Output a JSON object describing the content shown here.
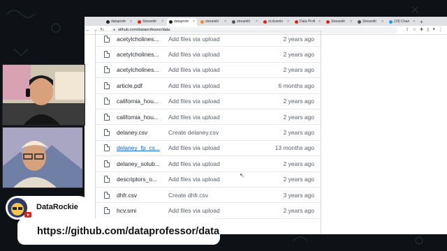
{
  "browser": {
    "tabs": [
      {
        "label": "dataprofe",
        "fav": "#222",
        "active": false
      },
      {
        "label": "Streamlit",
        "fav": "#e0241b",
        "active": false
      },
      {
        "label": "dataprofe",
        "fav": "#222",
        "active": true
      },
      {
        "label": "streamlit",
        "fav": "#f28b24",
        "active": false
      },
      {
        "label": "streamlit",
        "fav": "#555",
        "active": false
      },
      {
        "label": "st.downlo",
        "fav": "#e0241b",
        "active": false
      },
      {
        "label": "Data Profi",
        "fav": "#e0241b",
        "active": false
      },
      {
        "label": "Streamlit",
        "fav": "#e0241b",
        "active": false
      },
      {
        "label": "Streamlit",
        "fav": "#555",
        "active": false
      },
      {
        "label": "(19) Chan",
        "fav": "#1d9bf0",
        "active": false
      }
    ],
    "address": "github.com/dataprofessor/data"
  },
  "files": [
    {
      "name": "acetylcholines...",
      "message": "Add files via upload",
      "age": "2 years ago",
      "link": false
    },
    {
      "name": "acetylcholines...",
      "message": "Add files via upload",
      "age": "2 years ago",
      "link": false
    },
    {
      "name": "acetylcholines...",
      "message": "Add files via upload",
      "age": "2 years ago",
      "link": false
    },
    {
      "name": "article.pdf",
      "message": "Add files via upload",
      "age": "6 months ago",
      "link": false
    },
    {
      "name": "california_hou...",
      "message": "Add files via upload",
      "age": "2 years ago",
      "link": false
    },
    {
      "name": "california_hou...",
      "message": "Add files via upload",
      "age": "2 years ago",
      "link": false
    },
    {
      "name": "delaney.csv",
      "message": "Create delaney.csv",
      "age": "2 years ago",
      "link": false
    },
    {
      "name": "delaney_fp_cs...",
      "message": "Add files via upload",
      "age": "13 months ago",
      "link": true
    },
    {
      "name": "delaney_solub...",
      "message": "Add files via upload",
      "age": "2 years ago",
      "link": false
    },
    {
      "name": "descriptors_o...",
      "message": "Add files via upload",
      "age": "2 years ago",
      "link": false
    },
    {
      "name": "dhfr.csv",
      "message": "Create dhfr.csv",
      "age": "3 years ago",
      "link": false
    },
    {
      "name": "hcv.smi",
      "message": "Add files via upload",
      "age": "2 years ago",
      "link": false
    },
    {
      "name": "",
      "message": "",
      "age": "",
      "link": false
    }
  ],
  "overlay": {
    "channel_name": "DataRockie",
    "url_text": "https://github.com/dataprofessor/data"
  }
}
